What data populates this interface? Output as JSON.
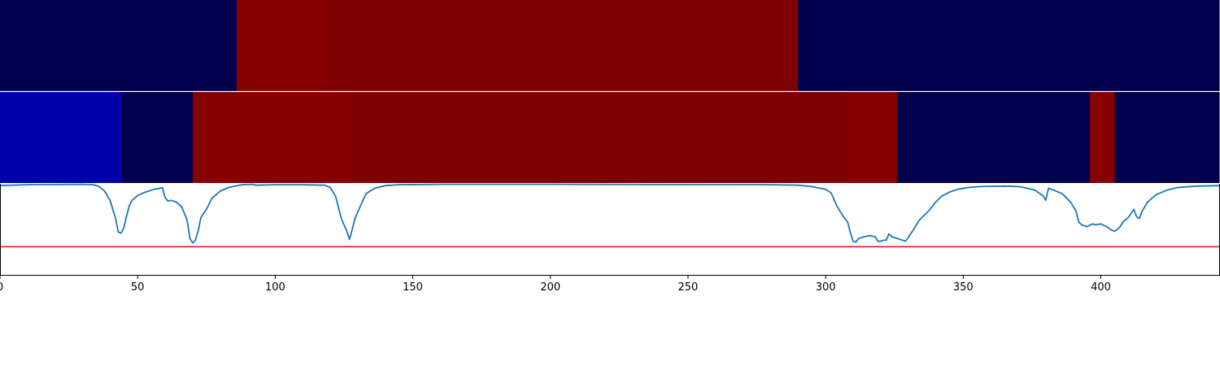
{
  "chart_data": [
    {
      "type": "heatmap",
      "segments": [
        {
          "x0": 0,
          "x1": 86,
          "color": "#00004c"
        },
        {
          "x0": 86,
          "x1": 119,
          "color": "#870000"
        },
        {
          "x0": 119,
          "x1": 290,
          "color": "#7f0000"
        },
        {
          "x0": 290,
          "x1": 443,
          "color": "#00004c"
        }
      ]
    },
    {
      "type": "heatmap",
      "segments": [
        {
          "x0": 0,
          "x1": 44,
          "color": "#0000aa"
        },
        {
          "x0": 44,
          "x1": 70,
          "color": "#00004c"
        },
        {
          "x0": 70,
          "x1": 128,
          "color": "#870000"
        },
        {
          "x0": 128,
          "x1": 308,
          "color": "#7f0000"
        },
        {
          "x0": 308,
          "x1": 326,
          "color": "#870000"
        },
        {
          "x0": 326,
          "x1": 396,
          "color": "#00004c"
        },
        {
          "x0": 396,
          "x1": 405,
          "color": "#870000"
        },
        {
          "x0": 405,
          "x1": 443,
          "color": "#00004c"
        }
      ]
    },
    {
      "type": "line",
      "xlim": [
        0,
        443
      ],
      "ylim": [
        0,
        1
      ],
      "xticks": [
        0,
        50,
        100,
        150,
        200,
        250,
        300,
        350,
        400
      ],
      "series": [
        {
          "color": "#1f77b4",
          "points": [
            [
              0,
              0.98
            ],
            [
              10,
              0.99
            ],
            [
              30,
              0.995
            ],
            [
              34,
              0.99
            ],
            [
              36,
              0.97
            ],
            [
              38,
              0.92
            ],
            [
              40,
              0.82
            ],
            [
              42,
              0.62
            ],
            [
              43,
              0.47
            ],
            [
              44,
              0.46
            ],
            [
              45,
              0.52
            ],
            [
              46,
              0.65
            ],
            [
              47,
              0.76
            ],
            [
              48,
              0.82
            ],
            [
              50,
              0.87
            ],
            [
              52,
              0.9
            ],
            [
              54,
              0.92
            ],
            [
              56,
              0.94
            ],
            [
              58,
              0.95
            ],
            [
              59,
              0.96
            ],
            [
              60,
              0.85
            ],
            [
              61,
              0.81
            ],
            [
              62,
              0.82
            ],
            [
              64,
              0.8
            ],
            [
              66,
              0.75
            ],
            [
              68,
              0.6
            ],
            [
              69,
              0.4
            ],
            [
              70,
              0.35
            ],
            [
              71,
              0.38
            ],
            [
              72,
              0.48
            ],
            [
              73,
              0.63
            ],
            [
              75,
              0.72
            ],
            [
              77,
              0.84
            ],
            [
              80,
              0.92
            ],
            [
              83,
              0.96
            ],
            [
              88,
              0.99
            ],
            [
              92,
              0.995
            ],
            [
              93,
              0.985
            ],
            [
              100,
              0.99
            ],
            [
              110,
              0.99
            ],
            [
              118,
              0.985
            ],
            [
              120,
              0.96
            ],
            [
              122,
              0.86
            ],
            [
              124,
              0.62
            ],
            [
              126,
              0.48
            ],
            [
              127,
              0.39
            ],
            [
              128,
              0.5
            ],
            [
              129,
              0.62
            ],
            [
              131,
              0.76
            ],
            [
              133,
              0.89
            ],
            [
              136,
              0.95
            ],
            [
              140,
              0.98
            ],
            [
              145,
              0.99
            ],
            [
              160,
              0.995
            ],
            [
              200,
              0.995
            ],
            [
              280,
              0.99
            ],
            [
              290,
              0.985
            ],
            [
              295,
              0.97
            ],
            [
              300,
              0.94
            ],
            [
              302,
              0.9
            ],
            [
              304,
              0.76
            ],
            [
              306,
              0.66
            ],
            [
              308,
              0.58
            ],
            [
              309,
              0.46
            ],
            [
              310,
              0.37
            ],
            [
              311,
              0.36
            ],
            [
              312,
              0.4
            ],
            [
              314,
              0.42
            ],
            [
              316,
              0.43
            ],
            [
              318,
              0.42
            ],
            [
              319,
              0.37
            ],
            [
              320,
              0.37
            ],
            [
              321,
              0.38
            ],
            [
              322,
              0.38
            ],
            [
              323,
              0.45
            ],
            [
              324,
              0.42
            ],
            [
              326,
              0.4
            ],
            [
              327,
              0.39
            ],
            [
              328,
              0.38
            ],
            [
              329,
              0.37
            ],
            [
              330,
              0.41
            ],
            [
              332,
              0.5
            ],
            [
              334,
              0.6
            ],
            [
              336,
              0.66
            ],
            [
              338,
              0.72
            ],
            [
              340,
              0.8
            ],
            [
              342,
              0.86
            ],
            [
              345,
              0.91
            ],
            [
              348,
              0.94
            ],
            [
              352,
              0.96
            ],
            [
              356,
              0.97
            ],
            [
              365,
              0.975
            ],
            [
              370,
              0.97
            ],
            [
              372,
              0.96
            ],
            [
              376,
              0.93
            ],
            [
              379,
              0.87
            ],
            [
              380,
              0.82
            ],
            [
              381,
              0.95
            ],
            [
              383,
              0.93
            ],
            [
              386,
              0.89
            ],
            [
              389,
              0.8
            ],
            [
              391,
              0.7
            ],
            [
              392,
              0.58
            ],
            [
              393,
              0.55
            ],
            [
              395,
              0.53
            ],
            [
              397,
              0.56
            ],
            [
              398,
              0.55
            ],
            [
              400,
              0.56
            ],
            [
              402,
              0.53
            ],
            [
              403,
              0.51
            ],
            [
              404,
              0.49
            ],
            [
              405,
              0.48
            ],
            [
              406,
              0.5
            ],
            [
              407,
              0.53
            ],
            [
              408,
              0.58
            ],
            [
              410,
              0.63
            ],
            [
              412,
              0.72
            ],
            [
              413,
              0.64
            ],
            [
              414,
              0.62
            ],
            [
              415,
              0.7
            ],
            [
              417,
              0.8
            ],
            [
              420,
              0.88
            ],
            [
              424,
              0.93
            ],
            [
              428,
              0.96
            ],
            [
              435,
              0.975
            ],
            [
              443,
              0.98
            ]
          ]
        },
        {
          "color": "#e41a1c",
          "points": [
            [
              0,
              0.31
            ],
            [
              443,
              0.31
            ]
          ]
        }
      ]
    }
  ]
}
